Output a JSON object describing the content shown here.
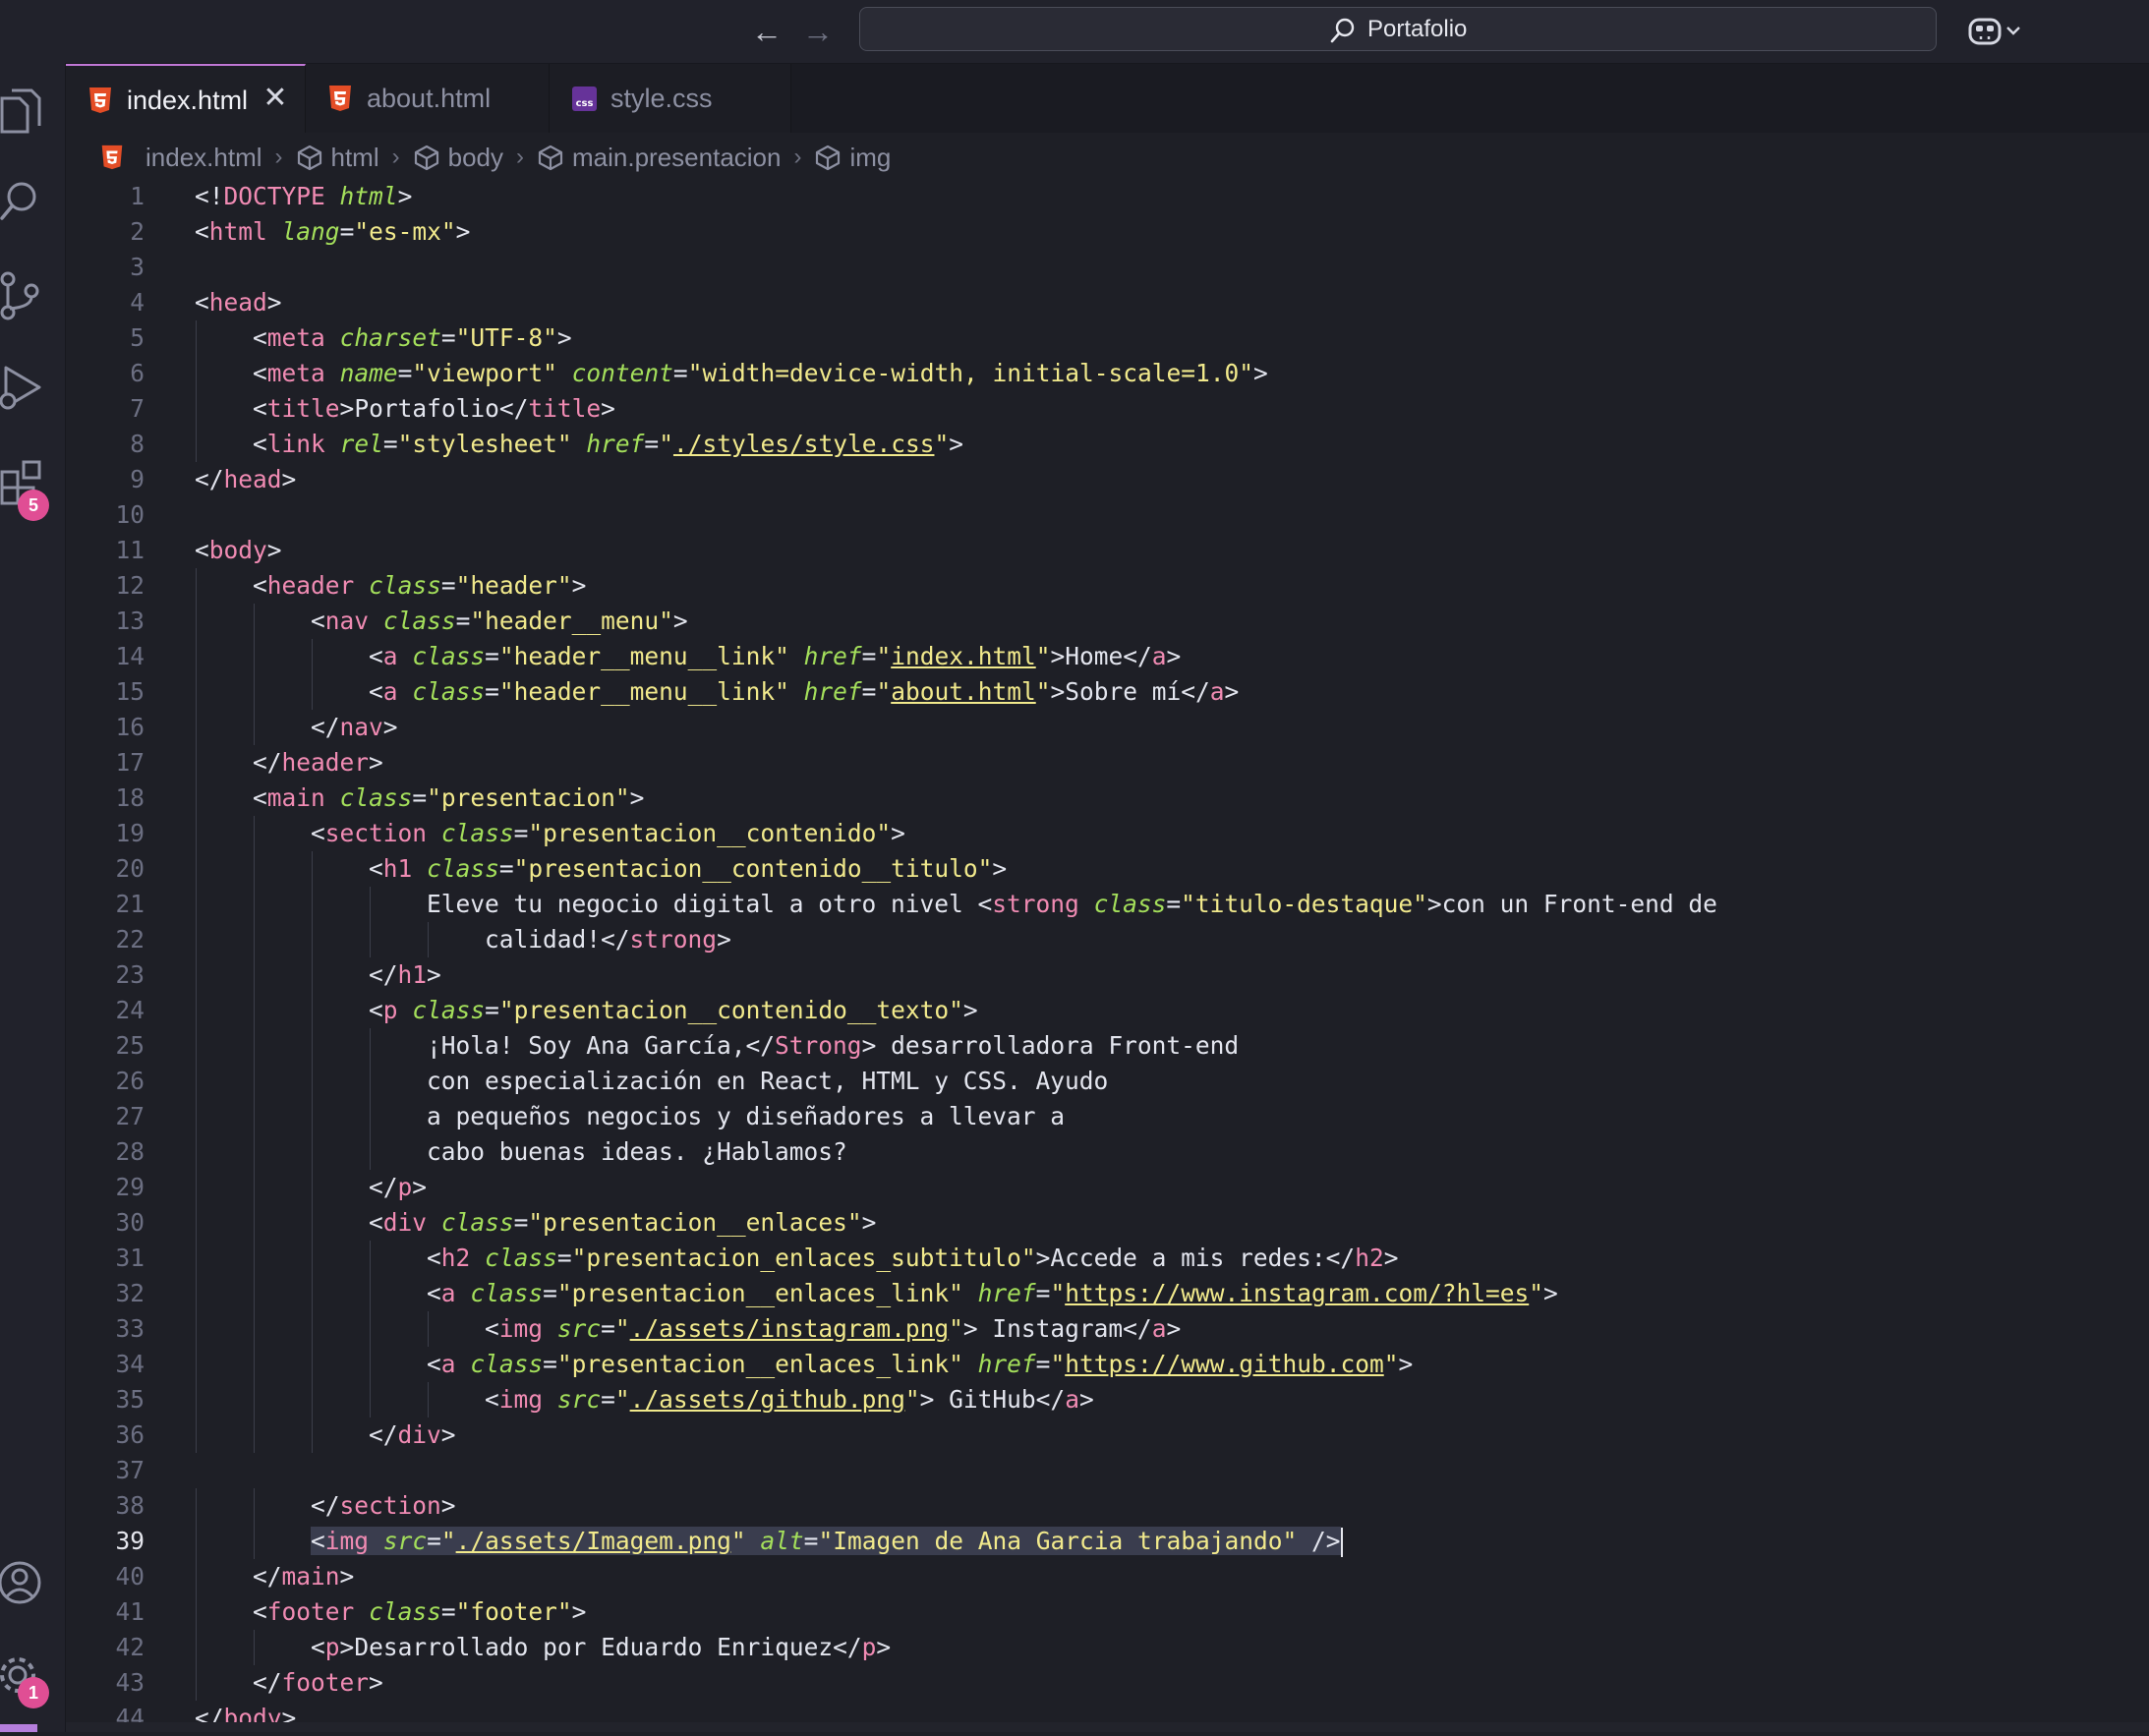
{
  "titlebar": {
    "search_label": "Portafolio",
    "back_icon": "arrow-left-icon",
    "forward_icon": "arrow-right-icon",
    "copilot_icon": "copilot-icon"
  },
  "activity_bar": {
    "items": [
      {
        "name": "explorer-icon"
      },
      {
        "name": "search-icon"
      },
      {
        "name": "source-control-icon"
      },
      {
        "name": "run-debug-icon"
      },
      {
        "name": "extensions-icon",
        "badge": "5"
      },
      {
        "name": "account-icon"
      },
      {
        "name": "settings-gear-icon",
        "badge": "1"
      }
    ]
  },
  "tabs": [
    {
      "label": "index.html",
      "icon": "html5-icon",
      "active": true
    },
    {
      "label": "about.html",
      "icon": "html5-icon",
      "active": false
    },
    {
      "label": "style.css",
      "icon": "css-icon",
      "active": false
    }
  ],
  "breadcrumb": [
    "index.html",
    "html",
    "body",
    "main.presentacion",
    "img"
  ],
  "editor": {
    "current_line": 39,
    "lines": [
      "<!DOCTYPE html>",
      "<html lang=\"es-mx\">",
      "",
      "<head>",
      "    <meta charset=\"UTF-8\">",
      "    <meta name=\"viewport\" content=\"width=device-width, initial-scale=1.0\">",
      "    <title>Portafolio</title>",
      "    <link rel=\"stylesheet\" href=\"./styles/style.css\">",
      "</head>",
      "",
      "<body>",
      "    <header class=\"header\">",
      "        <nav class=\"header__menu\">",
      "            <a class=\"header__menu__link\" href=\"index.html\">Home</a>",
      "            <a class=\"header__menu__link\" href=\"about.html\">Sobre mí</a>",
      "        </nav>",
      "    </header>",
      "    <main class=\"presentacion\">",
      "        <section class=\"presentacion__contenido\">",
      "            <h1 class=\"presentacion__contenido__titulo\">",
      "                Eleve tu negocio digital a otro nivel <strong class=\"titulo-destaque\">con un Front-end de",
      "                    calidad!</strong>",
      "            </h1>",
      "            <p class=\"presentacion__contenido__texto\">",
      "                ¡Hola! Soy Ana García,</Strong> desarrolladora Front-end",
      "                con especialización en React, HTML y CSS. Ayudo",
      "                a pequeños negocios y diseñadores a llevar a",
      "                cabo buenas ideas. ¿Hablamos?",
      "            </p>",
      "            <div class=\"presentacion__enlaces\">",
      "                <h2 class=\"presentacion_enlaces_subtitulo\">Accede a mis redes:</h2>",
      "                <a class=\"presentacion__enlaces_link\" href=\"https://www.instagram.com/?hl=es\">",
      "                    <img src=\"./assets/instagram.png\"> Instagram</a>",
      "                <a class=\"presentacion__enlaces_link\" href=\"https://www.github.com\">",
      "                    <img src=\"./assets/github.png\"> GitHub</a>",
      "            </div>",
      "",
      "        </section>",
      "        <img src=\"./assets/Imagem.png\" alt=\"Imagen de Ana Garcia trabajando\" />",
      "    </main>",
      "    <footer class=\"footer\">",
      "        <p>Desarrollado por Eduardo Enriquez</p>",
      "    </footer>",
      "</body>"
    ]
  },
  "colors": {
    "tag": "#f08bb3",
    "attribute": "#a4df5b",
    "string": "#f1e98c",
    "text": "#e3e5ee",
    "badge": "#e04e94",
    "accent": "#c178d6"
  }
}
